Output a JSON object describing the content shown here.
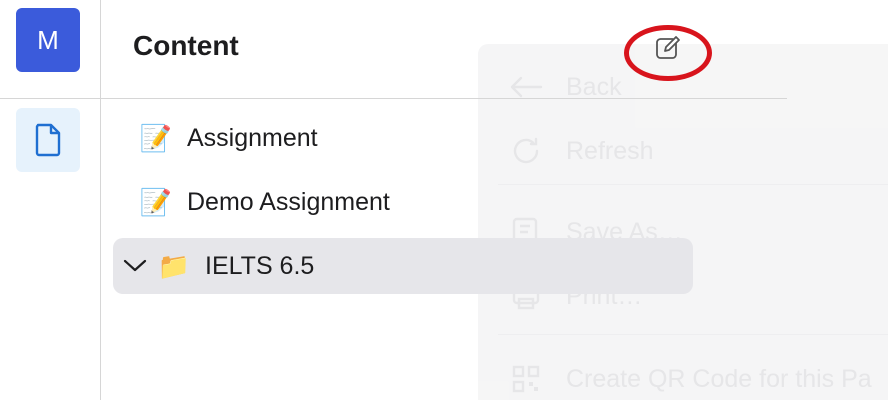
{
  "window": {
    "title": ""
  },
  "rail": {
    "avatar_letter": "M",
    "avatar_color": "#3b5bdb",
    "selected_bg": "#e6f2fc",
    "icon_color": "#1f6fd1",
    "items": [
      {
        "icon": "document-icon",
        "selected": true
      }
    ]
  },
  "panel": {
    "title": "Content",
    "edit_icon": "edit-icon",
    "tree": [
      {
        "emoji": "📝",
        "label": "Assignment",
        "type": "page"
      },
      {
        "emoji": "📝",
        "label": "Demo Assignment",
        "type": "page"
      },
      {
        "emoji": "📁",
        "label": "IELTS 6.5",
        "type": "folder",
        "expanded": true,
        "selected": true
      }
    ]
  },
  "context_menu": {
    "items": [
      {
        "icon": "arrow-left-icon",
        "label": "Back"
      },
      {
        "icon": "refresh-icon",
        "label": "Refresh"
      },
      {
        "icon": "save-icon",
        "label": "Save As…"
      },
      {
        "icon": "print-icon",
        "label": "Print…"
      },
      {
        "icon": "qr-code-icon",
        "label": "Create QR Code for this Pa"
      }
    ]
  },
  "annotation": {
    "ring_color": "#d8141c"
  }
}
